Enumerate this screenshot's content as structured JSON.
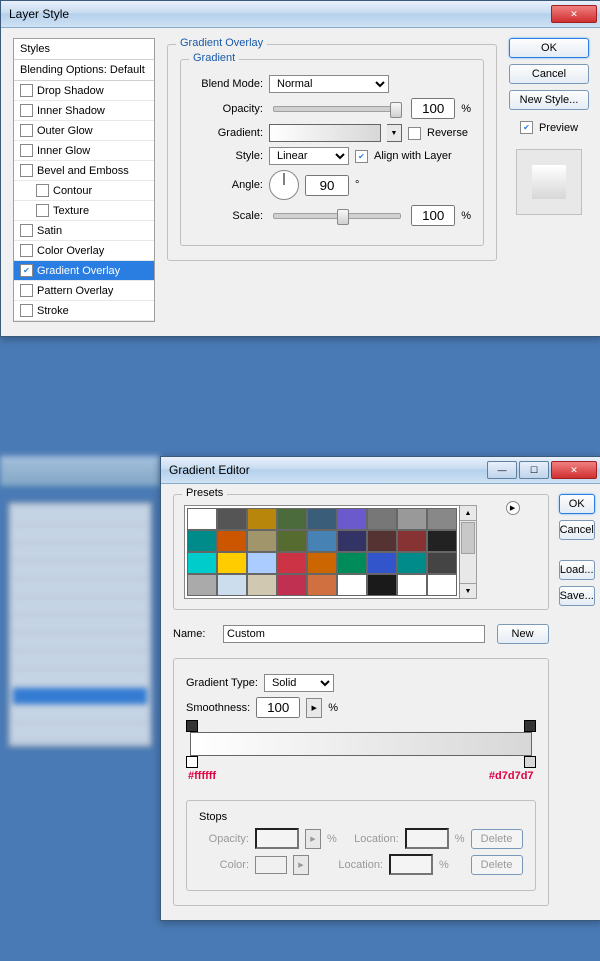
{
  "layerStyle": {
    "title": "Layer Style",
    "panelHead": "Styles",
    "panelSub": "Blending Options: Default",
    "items": [
      {
        "label": "Drop Shadow",
        "checked": false
      },
      {
        "label": "Inner Shadow",
        "checked": false
      },
      {
        "label": "Outer Glow",
        "checked": false
      },
      {
        "label": "Inner Glow",
        "checked": false
      },
      {
        "label": "Bevel and Emboss",
        "checked": false
      },
      {
        "label": "Contour",
        "checked": false,
        "indent": true
      },
      {
        "label": "Texture",
        "checked": false,
        "indent": true
      },
      {
        "label": "Satin",
        "checked": false
      },
      {
        "label": "Color Overlay",
        "checked": false
      },
      {
        "label": "Gradient Overlay",
        "checked": true,
        "selected": true
      },
      {
        "label": "Pattern Overlay",
        "checked": false
      },
      {
        "label": "Stroke",
        "checked": false
      }
    ],
    "groupTitle": "Gradient Overlay",
    "subGroup": "Gradient",
    "blendModeLabel": "Blend Mode:",
    "blendMode": "Normal",
    "opacityLabel": "Opacity:",
    "opacity": "100",
    "pct": "%",
    "gradientLabel": "Gradient:",
    "reverseLabel": "Reverse",
    "reverse": false,
    "styleLabel": "Style:",
    "style": "Linear",
    "alignLabel": "Align with Layer",
    "align": true,
    "angleLabel": "Angle:",
    "angle": "90",
    "deg": "°",
    "scaleLabel": "Scale:",
    "scale": "100",
    "ok": "OK",
    "cancel": "Cancel",
    "newStyle": "New Style...",
    "previewLabel": "Preview",
    "preview": true
  },
  "gradEditor": {
    "title": "Gradient Editor",
    "presetsLabel": "Presets",
    "swatches": [
      "#ffffff",
      "#555555",
      "#b8860b",
      "#4b6b3c",
      "#3a5d7a",
      "#6a5acd",
      "#777777",
      "#999999",
      "#888888",
      "#008b8b",
      "#cc5500",
      "#a0956b",
      "#556b2f",
      "#4682b4",
      "#333366",
      "#553333",
      "#883333",
      "#222222",
      "#00cccc",
      "#ffcc00",
      "#aaccff",
      "#cc3344",
      "#cc6600",
      "#008b5a",
      "#3355cc",
      "#008b8b",
      "#444444",
      "#aaaaaa",
      "#ccddee",
      "#d0c8b0",
      "#c03050",
      "#d07040",
      "#ffffff",
      "#1a1a1a",
      "#ffffff",
      "#ffffff"
    ],
    "nameLabel": "Name:",
    "name": "Custom",
    "newBtn": "New",
    "gtypeLabel": "Gradient Type:",
    "gtype": "Solid",
    "smoothLabel": "Smoothness:",
    "smooth": "100",
    "pct": "%",
    "leftStop": "#ffffff",
    "rightStop": "#d7d7d7",
    "stopsLabel": "Stops",
    "opLabel": "Opacity:",
    "locLabel": "Location:",
    "colorLabel": "Color:",
    "delete": "Delete",
    "ok": "OK",
    "cancel": "Cancel",
    "load": "Load...",
    "save": "Save..."
  }
}
